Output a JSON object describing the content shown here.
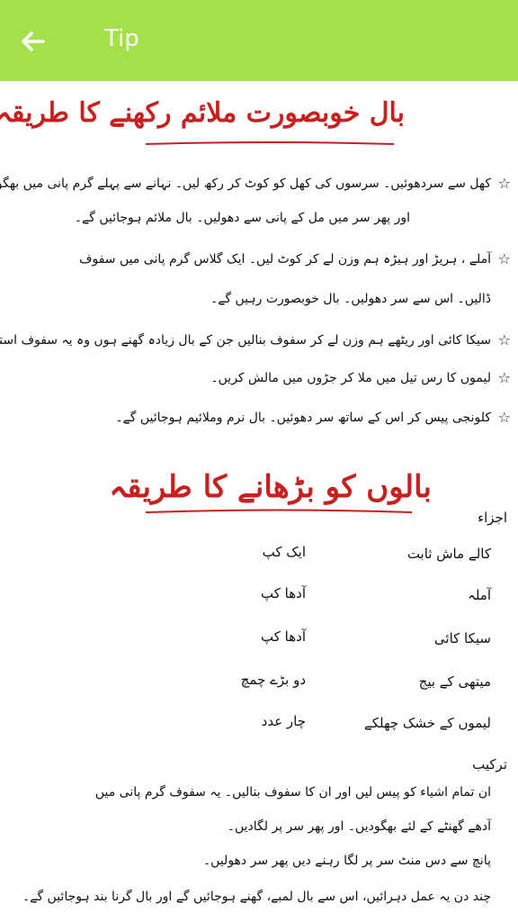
{
  "appbar": {
    "title": "Tip",
    "back_label": "←"
  },
  "section1": {
    "heading": "بال خوبصورت ملائم رکھنے کا طریقہ",
    "tips": [
      {
        "lines": [
          "کھل سے سردھوئیں۔ سرسوں کی کھل کو کوٹ کر رکھ لیں۔ نہانے سے پہلے گرم پانی میں بھگودیں۔",
          "اور پھر سر میں مل کے پانی سے دھولیں۔ بال ملائم ہوجائیں گے۔"
        ]
      },
      {
        "lines": [
          "آملے ، ہریڑ اور ہیڑہ ہم وزن لے کر کوٹ لیں۔ ایک گلاس گرم پانی میں سفوف",
          "ڈالیں۔ اس سے سر دھولیں۔ بال خوبصورت رہیں گے۔"
        ]
      },
      {
        "lines": [
          "سیکا کائی اور ریٹھے ہم وزن لے کر سفوف بنالیں جن کے بال زیادہ گھنے ہوں وہ یہ سفوف استعمال کریں۔"
        ]
      },
      {
        "lines": [
          "لیموں کا رس تیل میں ملا کر جڑوں میں مالش کریں۔"
        ]
      },
      {
        "lines": [
          "کلونجی پیس کر اس کے ساتھ سر دھوئیں۔ بال نرم وملائیم ہوجائیں گے۔"
        ]
      }
    ],
    "star_icon": "☆"
  },
  "section2": {
    "heading": "بالوں کو بڑھانے کا طریقہ",
    "ingredients_label": "اجزاء",
    "ingredients": [
      {
        "name": "کالے ماش ثابت",
        "qty": "ایک کپ"
      },
      {
        "name": "آملہ",
        "qty": "آدھا کپ"
      },
      {
        "name": "سیکا کائی",
        "qty": "آدھا کپ"
      },
      {
        "name": "میتھی کے بیج",
        "qty": "دو بڑے چمچ"
      },
      {
        "name": "لیموں کے خشک چھلکے",
        "qty": "چار عدد"
      }
    ],
    "method_label": "ترکیب",
    "method_lines": [
      "ان تمام اشیاء کو پیس لیں اور ان کا سفوف بنالیں۔ یہ سفوف گرم پانی میں",
      "آدھے گھنٹے کے لئے بھگودیں۔ اور پھر سر پر لگادیں۔",
      "پانچ سے دس منٹ سر پر لگا رہنے دیں پھر سر دھولیں۔",
      "چند دن یہ عمل دہرائیں، اس سے بال لمبے، گھنے ہوجائیں گے اور بال گرنا بند ہوجائیں گے۔"
    ]
  }
}
